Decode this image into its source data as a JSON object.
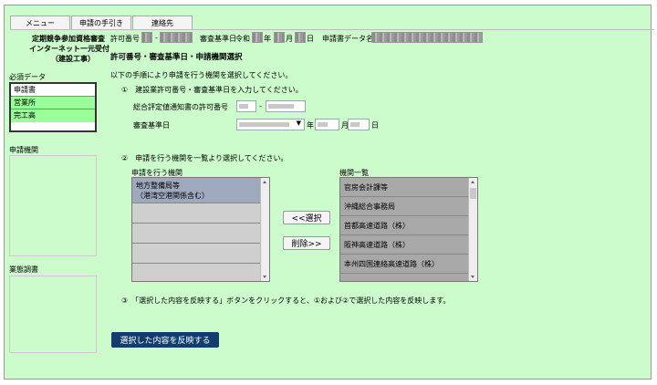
{
  "tabs": [
    "メニュー",
    "申請の手引き",
    "連絡先"
  ],
  "system_title": [
    "定期競争参加資格審査",
    "インターネット一元受付",
    "（建設工事）"
  ],
  "header": {
    "permit_label": "許可番号",
    "dash": "-",
    "base_date_label": "審査基準日",
    "era": "令和",
    "year_unit": "年",
    "month_unit": "月",
    "day_unit": "日",
    "data_name_label": "申請書データ名"
  },
  "section_title": "許可番号・審査基準日・申請機関選択",
  "sidebar": {
    "required_label": "必須データ",
    "required_items": [
      "申請書",
      "営業所",
      "完工高"
    ],
    "agency_label": "申請機関",
    "status_label": "業態調書"
  },
  "instructions": {
    "intro": "以下の手順により申請を行う機関を選択してください。",
    "step1": "①　建設業許可番号・審査基準日を入力してください。",
    "permit_number_label": "総合評定値通知書の許可番号",
    "dash": "-",
    "base_date_label": "審査基準日",
    "year_unit": "年",
    "month_unit": "月",
    "day_unit": "日",
    "step2": "②　申請を行う機関を一覧より選択してください。",
    "step3": "③　「選択した内容を反映する」ボタンをクリックすると、①および②で選択した内容を反映します。"
  },
  "selected_list": {
    "label": "申請を行う機関",
    "items": [
      [
        "地方整備局等",
        "（港湾空港関係含む）"
      ],
      [
        ""
      ],
      [
        ""
      ],
      [
        ""
      ],
      [
        ""
      ]
    ]
  },
  "agency_list": {
    "label": "機関一覧",
    "items": [
      "官房会計課等",
      "沖縄総合事務局",
      "首都高速道路（株）",
      "阪神高速道路（株）",
      "本州四国連絡高速道路（株）"
    ]
  },
  "buttons": {
    "select": "<<選択",
    "remove": "削除>>",
    "apply": "選択した内容を反映する"
  },
  "colors": {
    "page_bg": "#ccfccc",
    "primary_button": "#123d6e",
    "required_item_bg": "#99ff99"
  }
}
